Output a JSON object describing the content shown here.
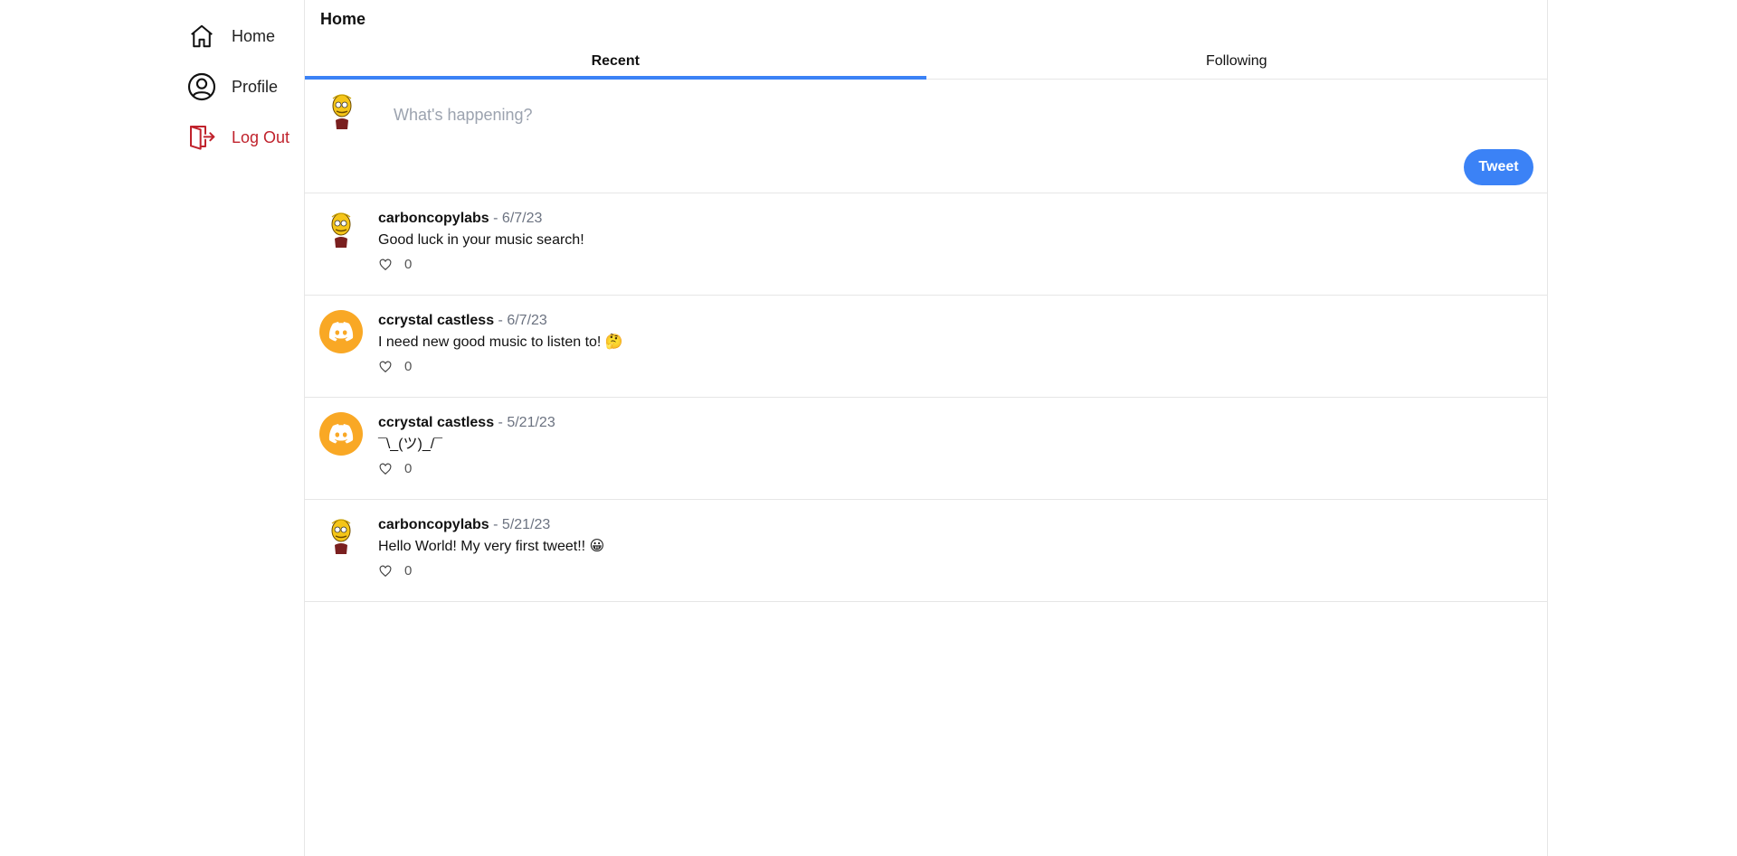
{
  "sidebar": {
    "items": [
      {
        "label": "Home",
        "icon": "home-icon"
      },
      {
        "label": "Profile",
        "icon": "user-circle-icon"
      },
      {
        "label": "Log Out",
        "icon": "logout-icon"
      }
    ]
  },
  "main": {
    "title": "Home",
    "tabs": [
      {
        "label": "Recent",
        "active": true
      },
      {
        "label": "Following",
        "active": false
      }
    ]
  },
  "composer": {
    "placeholder": "What's happening?",
    "button_label": "Tweet"
  },
  "feed": [
    {
      "author": "carboncopylabs",
      "sep": " - ",
      "date": "6/7/23",
      "text": "Good luck in your music search!",
      "likes": "0",
      "avatar": "cartoon-avatar"
    },
    {
      "author": "ccrystal castless",
      "sep": " - ",
      "date": "6/7/23",
      "text": "I need new good music to listen to! 🤔",
      "likes": "0",
      "avatar": "discord-avatar"
    },
    {
      "author": "ccrystal castless",
      "sep": " - ",
      "date": "5/21/23",
      "text": "¯\\_(ツ)_/¯",
      "likes": "0",
      "avatar": "discord-avatar"
    },
    {
      "author": "carboncopylabs",
      "sep": " - ",
      "date": "5/21/23",
      "text": "Hello World! My very first tweet!! 😀",
      "likes": "0",
      "avatar": "cartoon-avatar"
    }
  ],
  "colors": {
    "accent": "#3b82f6",
    "logout": "#c0222c",
    "discord_avatar": "#f9a825",
    "border": "#e6e6e6"
  }
}
